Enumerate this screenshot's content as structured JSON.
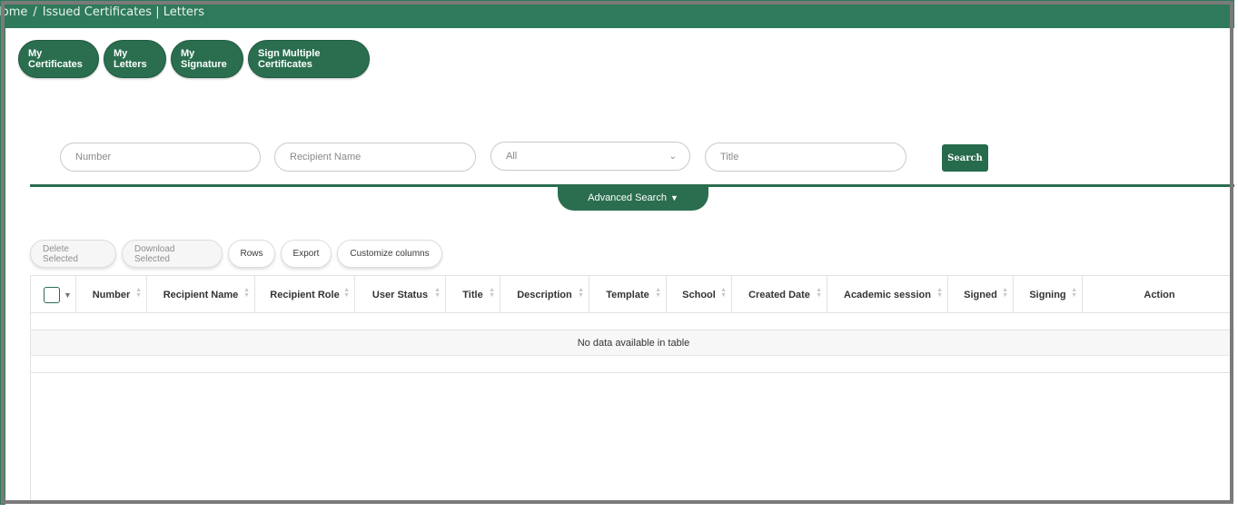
{
  "breadcrumb": {
    "home": "Home",
    "separator": "/",
    "current": "Issued Certificates | Letters"
  },
  "nav_buttons": [
    {
      "label": "My Certificates"
    },
    {
      "label": "My Letters"
    },
    {
      "label": "My Signature"
    },
    {
      "label": "Sign Multiple Certificates"
    }
  ],
  "search": {
    "number_placeholder": "Number",
    "recipient_placeholder": "Recipient Name",
    "status_selected": "All",
    "title_placeholder": "Title",
    "search_label": "Search",
    "advanced_label": "Advanced Search"
  },
  "toolbar": {
    "delete_label": "Delete Selected",
    "download_label": "Download Selected",
    "rows_label": "Rows",
    "export_label": "Export",
    "customize_label": "Customize columns"
  },
  "table": {
    "columns": [
      "Number",
      "Recipient Name",
      "Recipient Role",
      "User Status",
      "Title",
      "Description",
      "Template",
      "School",
      "Created Date",
      "Academic session",
      "Signed",
      "Signing",
      "Action"
    ],
    "empty_message": "No data available in table"
  },
  "colors": {
    "brand_green": "#2f7a5a",
    "button_green": "#2a6e4f"
  }
}
